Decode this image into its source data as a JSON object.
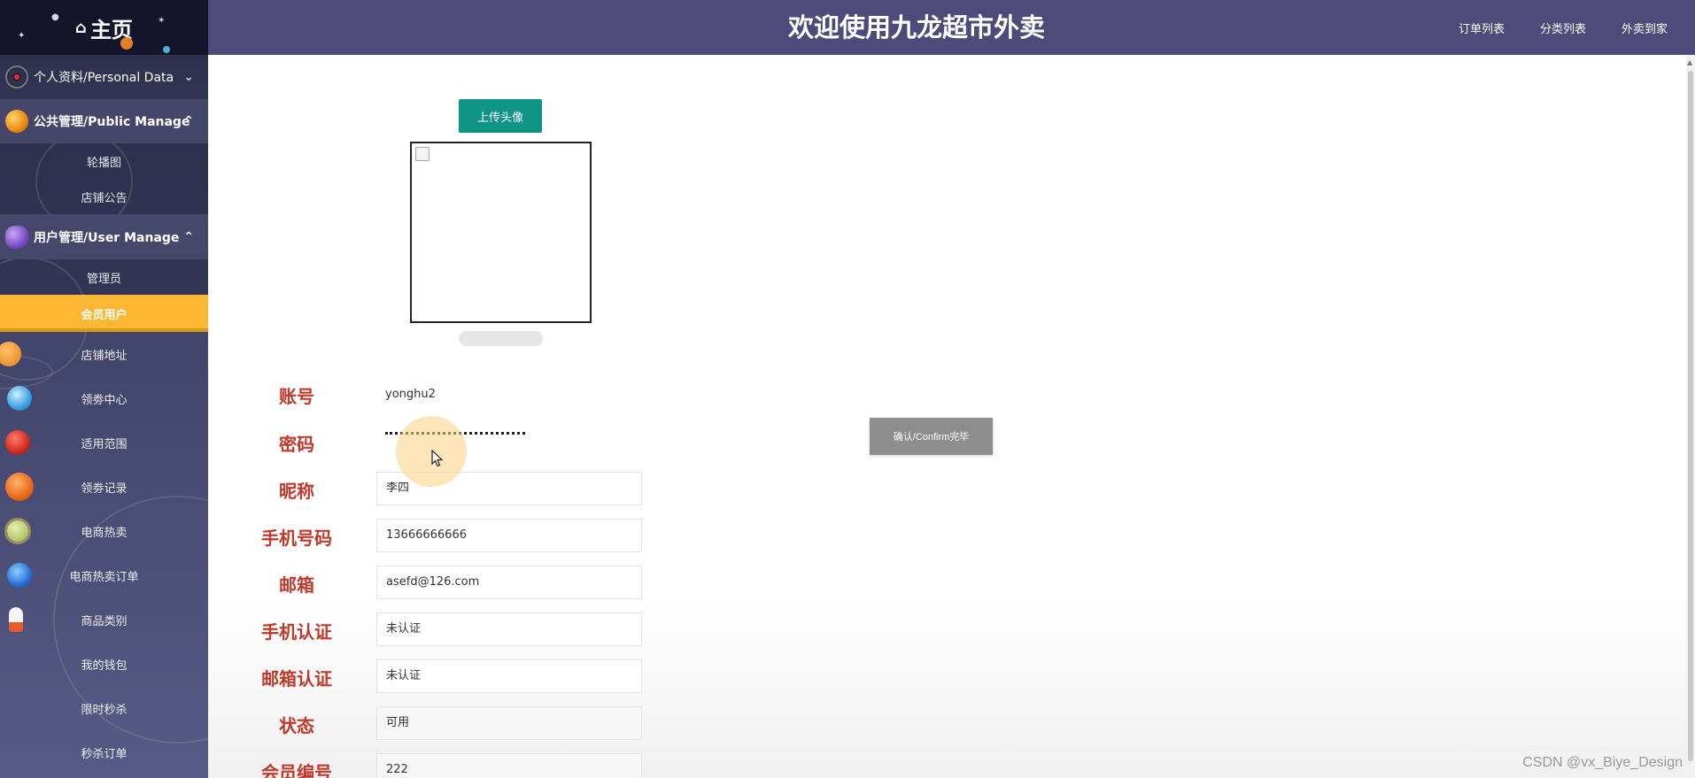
{
  "header": {
    "title": "欢迎使用九龙超市外卖",
    "nav": [
      "订单列表",
      "分类列表",
      "外卖到家"
    ]
  },
  "sidebar": {
    "home": "主页",
    "groups": [
      {
        "label": "个人资料/Personal Data",
        "expanded": false
      },
      {
        "label": "公共管理/Public Manage",
        "expanded": true,
        "children": [
          "轮播图",
          "店铺公告"
        ]
      },
      {
        "label": "用户管理/User Manage",
        "expanded": true,
        "children": [
          "管理员",
          "会员用户"
        ],
        "active_child": "会员用户"
      }
    ],
    "items": [
      "店铺地址",
      "领劵中心",
      "适用范围",
      "领劵记录",
      "电商热卖",
      "电商热卖订单",
      "商品类别",
      "我的钱包",
      "限时秒杀",
      "秒杀订单"
    ]
  },
  "form": {
    "upload_label": "上传头像",
    "account_label": "账号",
    "account_value": "yonghu2",
    "password_label": "密码",
    "nickname_label": "昵称",
    "nickname_value": "李四",
    "phone_label": "手机号码",
    "phone_value": "13666666666",
    "email_label": "邮箱",
    "email_value": "asefd@126.com",
    "phone_verify_label": "手机认证",
    "phone_verify_value": "未认证",
    "email_verify_label": "邮箱认证",
    "email_verify_value": "未认证",
    "status_label": "状态",
    "status_value": "可用",
    "member_no_label": "会员编号",
    "member_no_value": "222",
    "confirm_label": "确认/Confirm完毕"
  },
  "watermark": "CSDN @vx_Biye_Design",
  "colors": {
    "header_bg": "#4e4a7a",
    "sidebar_active": "#fdb833",
    "upload_button": "#109485",
    "label_red": "#c0392b",
    "confirm_button": "#8e8e8e"
  },
  "icons": {
    "home": "home-icon",
    "chevron_down": "chevron-down-icon",
    "chevron_up": "chevron-up-icon"
  }
}
